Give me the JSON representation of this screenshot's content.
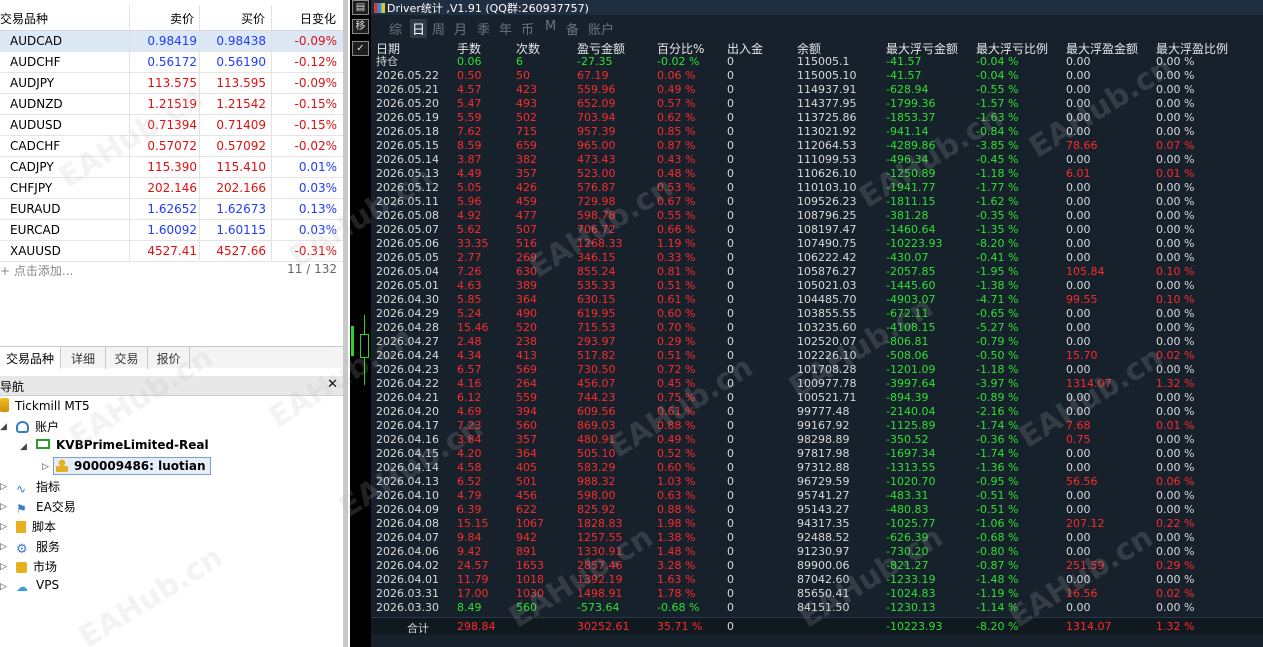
{
  "market_watch": {
    "header_title": "交易品种",
    "col_symbol": "交易品种",
    "col_bid": "卖价",
    "col_ask": "买价",
    "col_change": "日变化",
    "rows": [
      {
        "symbol": "AUDCAD",
        "bid": "0.98419",
        "ask": "0.98438",
        "change": "-0.09%",
        "dir": "up",
        "sel": true
      },
      {
        "symbol": "AUDCHF",
        "bid": "0.56172",
        "ask": "0.56190",
        "change": "-0.12%",
        "dir": "up"
      },
      {
        "symbol": "AUDJPY",
        "bid": "113.575",
        "ask": "113.595",
        "change": "-0.09%",
        "dir": "dn"
      },
      {
        "symbol": "AUDNZD",
        "bid": "1.21519",
        "ask": "1.21542",
        "change": "-0.15%",
        "dir": "dn"
      },
      {
        "symbol": "AUDUSD",
        "bid": "0.71394",
        "ask": "0.71409",
        "change": "-0.15%",
        "dir": "dn"
      },
      {
        "symbol": "CADCHF",
        "bid": "0.57072",
        "ask": "0.57092",
        "change": "-0.02%",
        "dir": "dn"
      },
      {
        "symbol": "CADJPY",
        "bid": "115.390",
        "ask": "115.410",
        "change": "0.01%",
        "dir": "dn"
      },
      {
        "symbol": "CHFJPY",
        "bid": "202.146",
        "ask": "202.166",
        "change": "0.03%",
        "dir": "dn"
      },
      {
        "symbol": "EURAUD",
        "bid": "1.62652",
        "ask": "1.62673",
        "change": "0.13%",
        "dir": "up"
      },
      {
        "symbol": "EURCAD",
        "bid": "1.60092",
        "ask": "1.60115",
        "change": "0.03%",
        "dir": "up"
      },
      {
        "symbol": "XAUUSD",
        "bid": "4527.41",
        "ask": "4527.66",
        "change": "-0.31%",
        "dir": "dn"
      }
    ],
    "add_label": "点击添加...",
    "count": "11 / 132"
  },
  "mw_tabs": [
    "交易品种",
    "详细",
    "交易",
    "报价"
  ],
  "navigator": {
    "title": "导航",
    "root": "Tickmill MT5",
    "accounts": "账户",
    "server": "KVBPrimeLimited-Real",
    "account": "900009486: luotian",
    "items": [
      "指标",
      "EA交易",
      "脚本",
      "服务",
      "市场",
      "VPS"
    ]
  },
  "driver": {
    "title": "Driver统计 ,V1.91 (QQ群:260937757)",
    "tabs": [
      "综",
      "日",
      "周",
      "月",
      "季",
      "年",
      "币",
      "M",
      "备",
      "账户"
    ],
    "active_tab": "日",
    "headers": [
      "日期",
      "手数",
      "次数",
      "盈亏金额",
      "百分比%",
      "出入金",
      "余额",
      "最大浮亏金额",
      "最大浮亏比例",
      "最大浮盈金额",
      "最大浮盈比例"
    ],
    "hold_row": [
      "持仓",
      "0.06",
      "6",
      "-27.35",
      "-0.02 %",
      "0",
      "115005.1",
      "-41.57",
      "-0.04 %",
      "0.00",
      "0.00 %"
    ],
    "rows": [
      [
        "2026.05.22",
        "0.50",
        "50",
        "67.19",
        "0.06 %",
        "0",
        "115005.10",
        "-41.57",
        "-0.04 %",
        "0.00",
        "0.00 %"
      ],
      [
        "2026.05.21",
        "4.57",
        "423",
        "559.96",
        "0.49 %",
        "0",
        "114937.91",
        "-628.94",
        "-0.55 %",
        "0.00",
        "0.00 %"
      ],
      [
        "2026.05.20",
        "5.47",
        "493",
        "652.09",
        "0.57 %",
        "0",
        "114377.95",
        "-1799.36",
        "-1.57 %",
        "0.00",
        "0.00 %"
      ],
      [
        "2026.05.19",
        "5.59",
        "502",
        "703.94",
        "0.62 %",
        "0",
        "113725.86",
        "-1853.37",
        "-1.63 %",
        "0.00",
        "0.00 %"
      ],
      [
        "2026.05.18",
        "7.62",
        "715",
        "957.39",
        "0.85 %",
        "0",
        "113021.92",
        "-941.14",
        "-0.84 %",
        "0.00",
        "0.00 %"
      ],
      [
        "2026.05.15",
        "8.59",
        "659",
        "965.00",
        "0.87 %",
        "0",
        "112064.53",
        "-4289.86",
        "-3.85 %",
        "78.66",
        "0.07 %"
      ],
      [
        "2026.05.14",
        "3.87",
        "382",
        "473.43",
        "0.43 %",
        "0",
        "111099.53",
        "-496.34",
        "-0.45 %",
        "0.00",
        "0.00 %"
      ],
      [
        "2026.05.13",
        "4.49",
        "357",
        "523.00",
        "0.48 %",
        "0",
        "110626.10",
        "-1250.89",
        "-1.18 %",
        "6.01",
        "0.01 %"
      ],
      [
        "2026.05.12",
        "5.05",
        "426",
        "576.87",
        "0.53 %",
        "0",
        "110103.10",
        "-1941.77",
        "-1.77 %",
        "0.00",
        "0.00 %"
      ],
      [
        "2026.05.11",
        "5.96",
        "459",
        "729.98",
        "0.67 %",
        "0",
        "109526.23",
        "-1811.15",
        "-1.62 %",
        "0.00",
        "0.00 %"
      ],
      [
        "2026.05.08",
        "4.92",
        "477",
        "598.78",
        "0.55 %",
        "0",
        "108796.25",
        "-381.28",
        "-0.35 %",
        "0.00",
        "0.00 %"
      ],
      [
        "2026.05.07",
        "5.62",
        "507",
        "706.72",
        "0.66 %",
        "0",
        "108197.47",
        "-1460.64",
        "-1.35 %",
        "0.00",
        "0.00 %"
      ],
      [
        "2026.05.06",
        "33.35",
        "516",
        "1268.33",
        "1.19 %",
        "0",
        "107490.75",
        "-10223.93",
        "-8.20 %",
        "0.00",
        "0.00 %"
      ],
      [
        "2026.05.05",
        "2.77",
        "269",
        "346.15",
        "0.33 %",
        "0",
        "106222.42",
        "-430.07",
        "-0.41 %",
        "0.00",
        "0.00 %"
      ],
      [
        "2026.05.04",
        "7.26",
        "630",
        "855.24",
        "0.81 %",
        "0",
        "105876.27",
        "-2057.85",
        "-1.95 %",
        "105.84",
        "0.10 %"
      ],
      [
        "2026.05.01",
        "4.63",
        "389",
        "535.33",
        "0.51 %",
        "0",
        "105021.03",
        "-1445.60",
        "-1.38 %",
        "0.00",
        "0.00 %"
      ],
      [
        "2026.04.30",
        "5.85",
        "364",
        "630.15",
        "0.61 %",
        "0",
        "104485.70",
        "-4903.07",
        "-4.71 %",
        "99.55",
        "0.10 %"
      ],
      [
        "2026.04.29",
        "5.24",
        "490",
        "619.95",
        "0.60 %",
        "0",
        "103855.55",
        "-672.11",
        "-0.65 %",
        "0.00",
        "0.00 %"
      ],
      [
        "2026.04.28",
        "15.46",
        "520",
        "715.53",
        "0.70 %",
        "0",
        "103235.60",
        "-4108.15",
        "-5.27 %",
        "0.00",
        "0.00 %"
      ],
      [
        "2026.04.27",
        "2.48",
        "238",
        "293.97",
        "0.29 %",
        "0",
        "102520.07",
        "-806.81",
        "-0.79 %",
        "0.00",
        "0.00 %"
      ],
      [
        "2026.04.24",
        "4.34",
        "413",
        "517.82",
        "0.51 %",
        "0",
        "102226.10",
        "-508.06",
        "-0.50 %",
        "15.70",
        "0.02 %"
      ],
      [
        "2026.04.23",
        "6.57",
        "569",
        "730.50",
        "0.72 %",
        "0",
        "101708.28",
        "-1201.09",
        "-1.18 %",
        "0.00",
        "0.00 %"
      ],
      [
        "2026.04.22",
        "4.16",
        "264",
        "456.07",
        "0.45 %",
        "0",
        "100977.78",
        "-3997.64",
        "-3.97 %",
        "1314.07",
        "1.32 %"
      ],
      [
        "2026.04.21",
        "6.12",
        "559",
        "744.23",
        "0.75 %",
        "0",
        "100521.71",
        "-894.39",
        "-0.89 %",
        "0.00",
        "0.00 %"
      ],
      [
        "2026.04.20",
        "4.69",
        "394",
        "609.56",
        "0.61 %",
        "0",
        "99777.48",
        "-2140.04",
        "-2.16 %",
        "0.00",
        "0.00 %"
      ],
      [
        "2026.04.17",
        "7.23",
        "560",
        "869.03",
        "0.88 %",
        "0",
        "99167.92",
        "-1125.89",
        "-1.74 %",
        "7.68",
        "0.01 %"
      ],
      [
        "2026.04.16",
        "3.84",
        "357",
        "480.91",
        "0.49 %",
        "0",
        "98298.89",
        "-350.52",
        "-0.36 %",
        "0.75",
        "0.00 %"
      ],
      [
        "2026.04.15",
        "4.20",
        "364",
        "505.10",
        "0.52 %",
        "0",
        "97817.98",
        "-1697.34",
        "-1.74 %",
        "0.00",
        "0.00 %"
      ],
      [
        "2026.04.14",
        "4.58",
        "405",
        "583.29",
        "0.60 %",
        "0",
        "97312.88",
        "-1313.55",
        "-1.36 %",
        "0.00",
        "0.00 %"
      ],
      [
        "2026.04.13",
        "6.52",
        "501",
        "988.32",
        "1.03 %",
        "0",
        "96729.59",
        "-1020.70",
        "-0.95 %",
        "56.56",
        "0.06 %"
      ],
      [
        "2026.04.10",
        "4.79",
        "456",
        "598.00",
        "0.63 %",
        "0",
        "95741.27",
        "-483.31",
        "-0.51 %",
        "0.00",
        "0.00 %"
      ],
      [
        "2026.04.09",
        "6.39",
        "622",
        "825.92",
        "0.88 %",
        "0",
        "95143.27",
        "-480.83",
        "-0.51 %",
        "0.00",
        "0.00 %"
      ],
      [
        "2026.04.08",
        "15.15",
        "1067",
        "1828.83",
        "1.98 %",
        "0",
        "94317.35",
        "-1025.77",
        "-1.06 %",
        "207.12",
        "0.22 %"
      ],
      [
        "2026.04.07",
        "9.84",
        "942",
        "1257.55",
        "1.38 %",
        "0",
        "92488.52",
        "-626.39",
        "-0.68 %",
        "0.00",
        "0.00 %"
      ],
      [
        "2026.04.06",
        "9.42",
        "891",
        "1330.91",
        "1.48 %",
        "0",
        "91230.97",
        "-730.20",
        "-0.80 %",
        "0.00",
        "0.00 %"
      ],
      [
        "2026.04.02",
        "24.57",
        "1653",
        "2857.46",
        "3.28 %",
        "0",
        "89900.06",
        "-821.27",
        "-0.87 %",
        "251.59",
        "0.29 %"
      ],
      [
        "2026.04.01",
        "11.79",
        "1018",
        "1392.19",
        "1.63 %",
        "0",
        "87042.60",
        "-1233.19",
        "-1.48 %",
        "0.00",
        "0.00 %"
      ],
      [
        "2026.03.31",
        "17.00",
        "1030",
        "1498.91",
        "1.78 %",
        "0",
        "85650.41",
        "-1024.83",
        "-1.19 %",
        "16.56",
        "0.02 %"
      ],
      [
        "2026.03.30",
        "8.49",
        "560",
        "-573.64",
        "-0.68 %",
        "0",
        "84151.50",
        "-1230.13",
        "-1.14 %",
        "0.00",
        "0.00 %"
      ]
    ],
    "summary": [
      "合计",
      "298.84",
      "",
      "30252.61",
      "35.71 %",
      "0",
      "",
      "-10223.93",
      "-8.20 %",
      "1314.07",
      "1.32 %"
    ]
  },
  "watermark": "EAHub.cn"
}
